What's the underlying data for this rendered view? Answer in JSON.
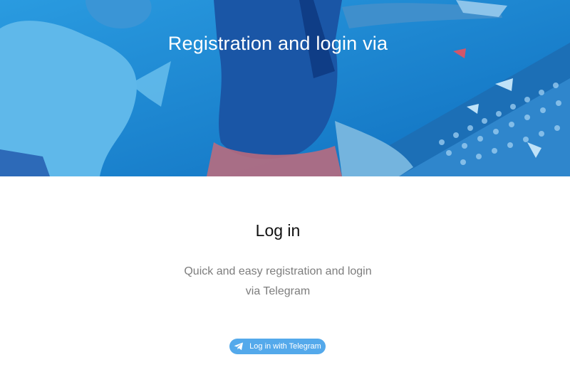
{
  "hero": {
    "title": "Registration and login via"
  },
  "login": {
    "heading": "Log in",
    "description_line1": "Quick and easy registration and login",
    "description_line2": "via Telegram",
    "button_label": "Log in with Telegram",
    "button_icon": "telegram-paper-plane-icon"
  },
  "colors": {
    "hero_background": "#1a86d4",
    "button_background": "#54a9eb",
    "description_text": "#7d7d7d"
  }
}
